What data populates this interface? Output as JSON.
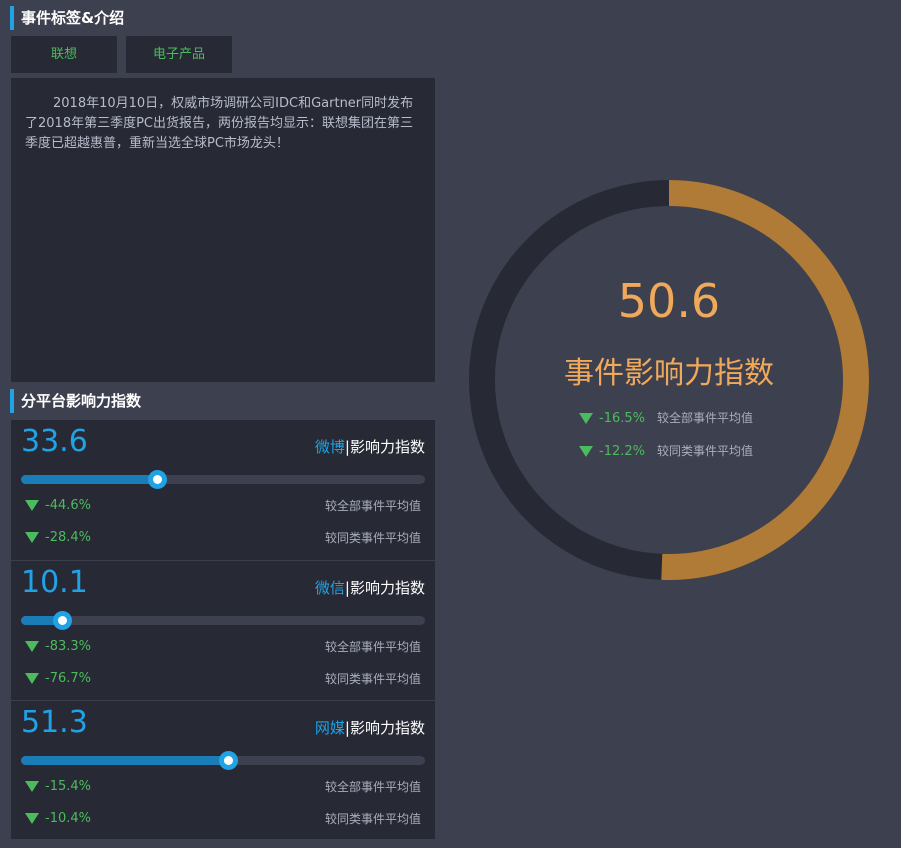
{
  "event_section": {
    "title": "事件标签&介绍",
    "tags": [
      "联想",
      "电子产品"
    ],
    "description": "2018年10月10日，权威市场调研公司IDC和Gartner同时发布了2018年第三季度PC出货报告，两份报告均显示：联想集团在第三季度已超越惠普，重新当选全球PC市场龙头！"
  },
  "platform_section": {
    "title": "分平台影响力指数",
    "label_suffix": "影响力指数",
    "separator": "|",
    "platforms": [
      {
        "value": "33.6",
        "level": 33.6,
        "name": "微博",
        "stats": [
          {
            "pct": "-44.6%",
            "desc": "较全部事件平均值"
          },
          {
            "pct": "-28.4%",
            "desc": "较同类事件平均值"
          }
        ]
      },
      {
        "value": "10.1",
        "level": 10.1,
        "name": "微信",
        "stats": [
          {
            "pct": "-83.3%",
            "desc": "较全部事件平均值"
          },
          {
            "pct": "-76.7%",
            "desc": "较同类事件平均值"
          }
        ]
      },
      {
        "value": "51.3",
        "level": 51.3,
        "name": "网媒",
        "stats": [
          {
            "pct": "-15.4%",
            "desc": "较全部事件平均值"
          },
          {
            "pct": "-10.4%",
            "desc": "较同类事件平均值"
          }
        ]
      }
    ]
  },
  "overall": {
    "value": "50.6",
    "level": 50.6,
    "label": "事件影响力指数",
    "stats": [
      {
        "pct": "-16.5%",
        "desc": "较全部事件平均值"
      },
      {
        "pct": "-12.2%",
        "desc": "较同类事件平均值"
      }
    ]
  },
  "colors": {
    "accent_blue": "#1fa2e6",
    "ring_orange": "#b07a37",
    "value_orange": "#f0a95a",
    "decrease_green": "#4cbb5d"
  }
}
